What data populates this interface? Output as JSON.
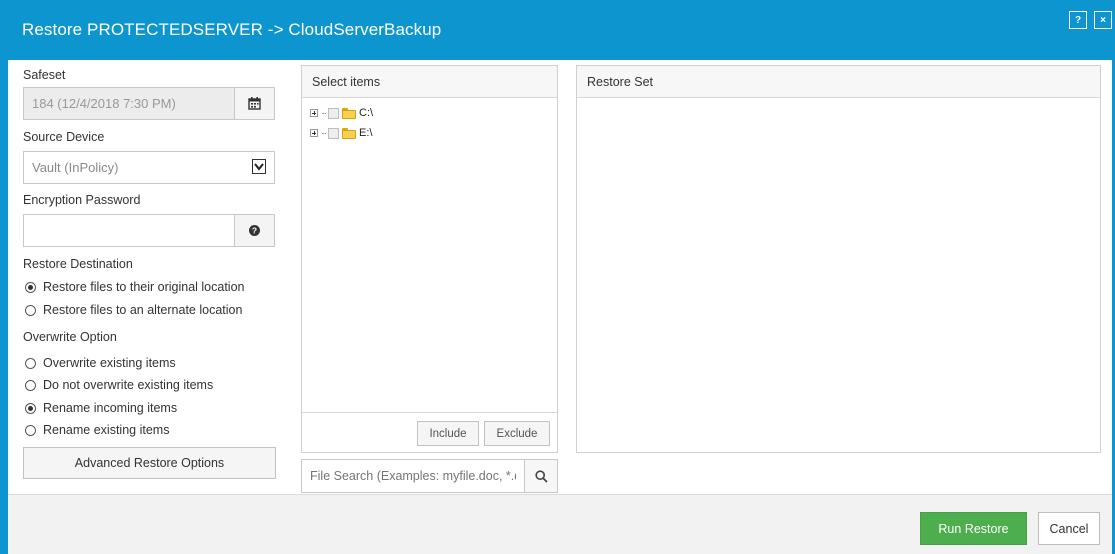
{
  "window": {
    "title": "Restore PROTECTEDSERVER -> CloudServerBackup",
    "help_label": "?",
    "close_label": "×"
  },
  "left": {
    "safeset_label": "Safeset",
    "safeset_value": "184 (12/4/2018 7:30 PM)",
    "source_device_label": "Source Device",
    "source_device_value": "Vault (InPolicy)",
    "encryption_password_label": "Encryption Password",
    "encryption_password_value": "",
    "restore_destination_label": "Restore Destination",
    "restore_destination_options": [
      {
        "label": "Restore files to their original location",
        "selected": true
      },
      {
        "label": "Restore files to an alternate location",
        "selected": false
      }
    ],
    "overwrite_option_label": "Overwrite Option",
    "overwrite_options": [
      {
        "label": "Overwrite existing items",
        "selected": false
      },
      {
        "label": "Do not overwrite existing items",
        "selected": false
      },
      {
        "label": "Rename incoming items",
        "selected": true
      },
      {
        "label": "Rename existing items",
        "selected": false
      }
    ],
    "advanced_button": "Advanced Restore Options"
  },
  "select_items": {
    "title": "Select items",
    "tree": [
      {
        "label": "C:\\",
        "checked": false
      },
      {
        "label": "E:\\",
        "checked": false
      }
    ],
    "include_label": "Include",
    "exclude_label": "Exclude",
    "search_placeholder": "File Search (Examples: myfile.doc, *.doc)"
  },
  "restore_set": {
    "title": "Restore Set"
  },
  "footer": {
    "run_label": "Run Restore",
    "cancel_label": "Cancel"
  },
  "colors": {
    "title_bar": "#0d95cf",
    "run_button": "#4cae4c"
  }
}
